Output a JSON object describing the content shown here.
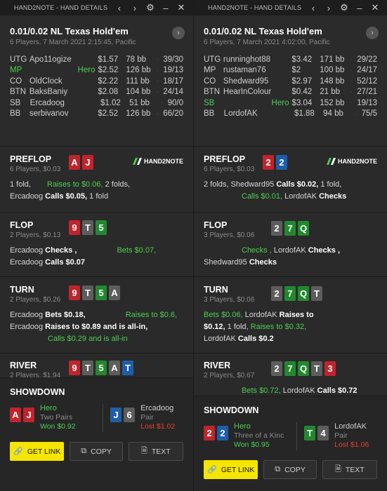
{
  "left": {
    "title": "HAND2NOTE - HAND DETAILS",
    "game": "0.01/0.02 NL Texas Hold'em",
    "subtitle": "6 Players, 7 March 2021 2:15:45, Pacific",
    "players": [
      {
        "pos": "UTG",
        "name": "Apo11ogize",
        "amt": "$1.57",
        "bb": "78 bb",
        "stat": "39/30",
        "hero": false
      },
      {
        "pos": "MP",
        "name": "Hero",
        "amt": "$2.52",
        "bb": "126 bb",
        "stat": "19/13",
        "hero": true
      },
      {
        "pos": "CO",
        "name": "OldClock",
        "amt": "$2.22",
        "bb": "111 bb",
        "stat": "18/17",
        "hero": false
      },
      {
        "pos": "BTN",
        "name": "BaksBaniy",
        "amt": "$2.08",
        "bb": "104 bb",
        "stat": "24/14",
        "hero": false
      },
      {
        "pos": "SB",
        "name": "Ercadoog",
        "amt": "$1.02",
        "bb": "51 bb",
        "stat": "90/0",
        "hero": false
      },
      {
        "pos": "BB",
        "name": "serbivanov",
        "amt": "$2.52",
        "bb": "126 bb",
        "stat": "66/20",
        "hero": false
      }
    ],
    "preflop": {
      "name": "PREFLOP",
      "info": "6 Players, $0.03",
      "cards": [
        {
          "r": "A",
          "c": "red"
        },
        {
          "r": "J",
          "c": "red"
        }
      ],
      "logo": "HAND2NOTE"
    },
    "preflop_lines": [
      [
        {
          "t": "1 fold, ",
          "s": ""
        },
        {
          "t": "Raises to $0.06, ",
          "s": "g"
        },
        {
          "t": "2 folds,",
          "s": ""
        }
      ],
      [
        {
          "t": "Ercadoog ",
          "s": ""
        },
        {
          "t": "Calls $0.05, ",
          "s": "b"
        },
        {
          "t": "1 fold",
          "s": ""
        }
      ]
    ],
    "flop": {
      "name": "FLOP",
      "info": "2 Players, $0.13",
      "cards": [
        {
          "r": "9",
          "c": "red"
        },
        {
          "r": "T",
          "c": "gray"
        },
        {
          "r": "5",
          "c": "green"
        }
      ]
    },
    "flop_lines": [
      [
        {
          "t": "Ercadoog ",
          "s": ""
        },
        {
          "t": "Checks , ",
          "s": "b"
        },
        {
          "t": "Bets $0.07,",
          "s": "g"
        }
      ],
      [
        {
          "t": "Ercadoog ",
          "s": ""
        },
        {
          "t": "Calls $0.07",
          "s": "b"
        }
      ]
    ],
    "turn": {
      "name": "TURN",
      "info": "2 Players, $0.26",
      "cards": [
        {
          "r": "9",
          "c": "red"
        },
        {
          "r": "T",
          "c": "gray"
        },
        {
          "r": "5",
          "c": "green"
        },
        {
          "r": "A",
          "c": "gray"
        }
      ]
    },
    "turn_lines": [
      [
        {
          "t": "Ercadoog ",
          "s": ""
        },
        {
          "t": "Bets $0.18, ",
          "s": "b"
        },
        {
          "t": "Raises to $0.6,",
          "s": "g"
        }
      ],
      [
        {
          "t": "Ercadoog ",
          "s": ""
        },
        {
          "t": "Raises to $0.89 and is all-in,",
          "s": "b"
        }
      ],
      [
        {
          "t": "Calls $0.29 and is all-in",
          "s": "g"
        }
      ]
    ],
    "river": {
      "name": "RIVER",
      "info": "2 Players, $1.94",
      "cards": [
        {
          "r": "9",
          "c": "red"
        },
        {
          "r": "T",
          "c": "gray"
        },
        {
          "r": "5",
          "c": "green"
        },
        {
          "r": "A",
          "c": "gray"
        },
        {
          "r": "T",
          "c": "blue"
        }
      ]
    },
    "showdown": {
      "name": "SHOWDOWN",
      "a": {
        "cards": [
          {
            "r": "A",
            "c": "red"
          },
          {
            "r": "J",
            "c": "red"
          }
        ],
        "player": "Hero",
        "hand": "Two Pairs",
        "result": "Won $0.92",
        "won": true
      },
      "b": {
        "cards": [
          {
            "r": "J",
            "c": "blue"
          },
          {
            "r": "6",
            "c": "gray"
          }
        ],
        "player": "Ercadoog",
        "hand": "Pair",
        "result": "Lost $1.02",
        "won": false
      }
    },
    "buttons": {
      "link": "GET LINK",
      "copy": "COPY",
      "text": "TEXT"
    }
  },
  "right": {
    "title": "HAND2NOTE - HAND DETAILS",
    "game": "0.01/0.02 NL Texas Hold'em",
    "subtitle": "6 Players, 7 March 2021 4:02:00, Pacific",
    "players": [
      {
        "pos": "UTG",
        "name": "runninghot88",
        "amt": "$3.42",
        "bb": "171 bb",
        "stat": "29/22",
        "hero": false
      },
      {
        "pos": "MP",
        "name": "rustaman76",
        "amt": "$2",
        "bb": "100 bb",
        "stat": "24/17",
        "hero": false
      },
      {
        "pos": "CO",
        "name": "Shedward95",
        "amt": "$2.97",
        "bb": "148 bb",
        "stat": "52/12",
        "hero": false
      },
      {
        "pos": "BTN",
        "name": "HearInColour",
        "amt": "$0.42",
        "bb": "21 bb",
        "stat": "27/21",
        "hero": false
      },
      {
        "pos": "SB",
        "name": "Hero",
        "amt": "$3.04",
        "bb": "152 bb",
        "stat": "19/13",
        "hero": true
      },
      {
        "pos": "BB",
        "name": "LordofAK",
        "amt": "$1.88",
        "bb": "94 bb",
        "stat": "75/5",
        "hero": false
      }
    ],
    "preflop": {
      "name": "PREFLOP",
      "info": "6 Players, $0.03",
      "cards": [
        {
          "r": "2",
          "c": "red"
        },
        {
          "r": "2",
          "c": "blue"
        }
      ],
      "logo": "HAND2NOTE"
    },
    "preflop_lines": [
      [
        {
          "t": "2 folds, Shedward95 ",
          "s": ""
        },
        {
          "t": "Calls $0.02, ",
          "s": "b"
        },
        {
          "t": "1 fold,",
          "s": ""
        }
      ],
      [
        {
          "t": "Calls $0.01, ",
          "s": "g"
        },
        {
          "t": "LordofAK ",
          "s": ""
        },
        {
          "t": "Checks",
          "s": "b"
        }
      ]
    ],
    "flop": {
      "name": "FLOP",
      "info": "3 Players, $0.06",
      "cards": [
        {
          "r": "2",
          "c": "gray"
        },
        {
          "r": "7",
          "c": "green"
        },
        {
          "r": "Q",
          "c": "green"
        }
      ]
    },
    "flop_lines": [
      [
        {
          "t": "Checks , ",
          "s": "g"
        },
        {
          "t": "LordofAK ",
          "s": ""
        },
        {
          "t": "Checks , ",
          "s": "b"
        }
      ],
      [
        {
          "t": "Shedward95 ",
          "s": ""
        },
        {
          "t": "Checks",
          "s": "b"
        }
      ]
    ],
    "turn": {
      "name": "TURN",
      "info": "3 Players, $0.06",
      "cards": [
        {
          "r": "2",
          "c": "gray"
        },
        {
          "r": "7",
          "c": "green"
        },
        {
          "r": "Q",
          "c": "green"
        },
        {
          "r": "T",
          "c": "gray"
        }
      ]
    },
    "turn_lines": [
      [
        {
          "t": "Bets $0.06, ",
          "s": "g"
        },
        {
          "t": "LordofAK ",
          "s": ""
        },
        {
          "t": "Raises to",
          "s": "b"
        }
      ],
      [
        {
          "t": "$0.12, ",
          "s": "b"
        },
        {
          "t": "1 fold, ",
          "s": ""
        },
        {
          "t": "Raises to $0.32,",
          "s": "g"
        }
      ],
      [
        {
          "t": "LordofAK ",
          "s": ""
        },
        {
          "t": "Calls $0.2",
          "s": "b"
        }
      ]
    ],
    "river": {
      "name": "RIVER",
      "info": "2 Players, $0.67",
      "cards": [
        {
          "r": "2",
          "c": "gray"
        },
        {
          "r": "7",
          "c": "green"
        },
        {
          "r": "Q",
          "c": "green"
        },
        {
          "r": "T",
          "c": "gray"
        },
        {
          "r": "3",
          "c": "red"
        }
      ]
    },
    "river_lines": [
      [
        {
          "t": "Bets $0.72, ",
          "s": "g"
        },
        {
          "t": "LordofAK ",
          "s": ""
        },
        {
          "t": "Calls $0.72",
          "s": "b"
        }
      ]
    ],
    "showdown": {
      "name": "SHOWDOWN",
      "a": {
        "cards": [
          {
            "r": "2",
            "c": "red"
          },
          {
            "r": "2",
            "c": "blue"
          }
        ],
        "player": "Hero",
        "hand": "Three of a Kinc",
        "result": "Won $0.95",
        "won": true
      },
      "b": {
        "cards": [
          {
            "r": "T",
            "c": "green"
          },
          {
            "r": "4",
            "c": "gray"
          }
        ],
        "player": "LordofAK",
        "hand": "Pair",
        "result": "Lost $1.06",
        "won": false
      }
    },
    "buttons": {
      "link": "GET LINK",
      "copy": "COPY",
      "text": "TEXT"
    }
  },
  "colors": {
    "hero_green": "#4ccf50",
    "loss_red": "#e2402f",
    "primary_yellow": "#f6e500"
  }
}
